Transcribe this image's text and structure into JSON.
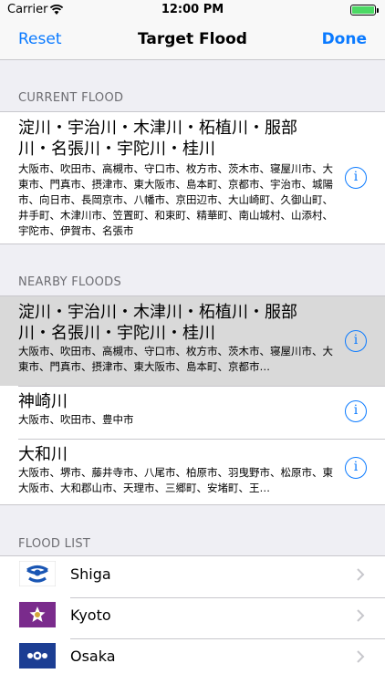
{
  "status_bar": {
    "carrier": "Carrier",
    "time": "12:00 PM"
  },
  "nav": {
    "reset": "Reset",
    "title": "Target Flood",
    "done": "Done"
  },
  "current_section": {
    "header": "CURRENT FLOOD",
    "item": {
      "title": "淀川・宇治川・木津川・柘植川・服部川・名張川・宇陀川・桂川",
      "subtitle": "大阪市、吹田市、高槻市、守口市、枚方市、茨木市、寝屋川市、大東市、門真市、摂津市、東大阪市、島本町、京都市、宇治市、城陽市、向日市、長岡京市、八幡市、京田辺市、大山崎町、久御山町、井手町、木津川市、笠置町、和束町、精華町、南山城村、山添村、宇陀市、伊賀市、名張市"
    }
  },
  "nearby_section": {
    "header": "NEARBY FLOODS",
    "items": [
      {
        "title": "淀川・宇治川・木津川・柘植川・服部川・名張川・宇陀川・桂川",
        "subtitle": "大阪市、吹田市、高槻市、守口市、枚方市、茨木市、寝屋川市、大東市、門真市、摂津市、東大阪市、島本町、京都市…"
      },
      {
        "title": "神崎川",
        "subtitle": "大阪市、吹田市、豊中市"
      },
      {
        "title": "大和川",
        "subtitle": "大阪市、堺市、藤井寺市、八尾市、柏原市、羽曳野市、松原市、東大阪市、大和郡山市、天理市、三郷町、安堵町、王…"
      }
    ]
  },
  "flood_list": {
    "header": "FLOOD LIST",
    "items": [
      {
        "label": "Shiga",
        "flag_color": "#1a56b4"
      },
      {
        "label": "Kyoto",
        "flag_color": "#7a2b8c"
      },
      {
        "label": "Osaka",
        "flag_color": "#1c3e93"
      }
    ]
  },
  "colors": {
    "accent": "#0a7aff",
    "selected_bg": "#d9d9d9",
    "section_bg": "#efeff4"
  }
}
